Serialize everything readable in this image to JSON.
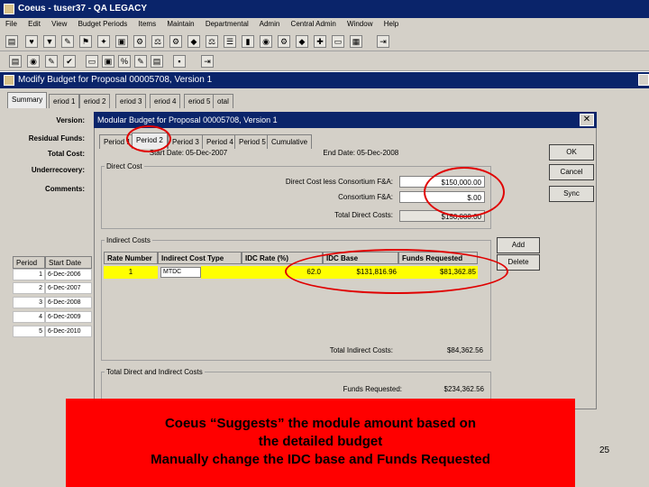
{
  "window": {
    "title": "Coeus - tuser37 - QA LEGACY"
  },
  "menu": [
    "File",
    "Edit",
    "View",
    "Budget Periods",
    "Items",
    "Maintain",
    "Departmental",
    "Admin",
    "Central Admin",
    "Window",
    "Help"
  ],
  "mdi_title": "Modify Budget for Proposal 00005708, Version 1",
  "main_tabs": [
    "Summary",
    "eriod 1",
    "eriod 2",
    "eriod 3",
    "eriod 4",
    "eriod 5",
    "otal"
  ],
  "summary_labels": {
    "version": "Version:",
    "residual_funds": "Residual Funds:",
    "total_cost": "Total Cost:",
    "underrecovery": "Underrecovery:",
    "comments": "Comments:"
  },
  "periods_grid": {
    "headers": [
      "Period",
      "Start Date"
    ],
    "rows": [
      [
        "1",
        "6-Dec-2006"
      ],
      [
        "2",
        "6-Dec-2007"
      ],
      [
        "3",
        "6-Dec-2008"
      ],
      [
        "4",
        "6-Dec-2009"
      ],
      [
        "5",
        "6-Dec-2010"
      ]
    ]
  },
  "dialog": {
    "title": "Modular Budget for Proposal 00005708, Version 1",
    "close_label": "✕",
    "tabs": [
      "Period 1",
      "Period 2",
      "Period 3",
      "Period 4",
      "Period 5",
      "Cumulative"
    ],
    "start_date_label": "Start Date:",
    "start_date": "05-Dec-2007",
    "end_date_label": "End Date:",
    "end_date": "05-Dec-2008",
    "direct_cost_group": "Direct Cost",
    "direct_less_label": "Direct Cost less Consortium F&A:",
    "direct_less_value": "$150,000.00",
    "consortium_label": "Consortium F&A:",
    "consortium_value": "$.00",
    "total_direct_label": "Total Direct Costs:",
    "total_direct_value": "$150,000.00",
    "indirect_group": "Indirect Costs",
    "indirect_headers": [
      "Rate Number",
      "Indirect Cost Type",
      "IDC Rate (%)",
      "IDC Base",
      "Funds Requested"
    ],
    "indirect_row": [
      "1",
      "MTDC",
      "62.0",
      "$131,816.96",
      "$81,362.85"
    ],
    "total_indirect_label": "Total Indirect Costs:",
    "total_indirect_value": "$84,362.56",
    "total_di_group": "Total Direct and Indirect Costs",
    "funds_requested_label": "Funds Requested:",
    "funds_requested_value": "$234,362.56",
    "buttons": {
      "ok": "OK",
      "cancel": "Cancel",
      "sync": "Sync",
      "add": "Add",
      "delete": "Delete"
    }
  },
  "callout": {
    "line1": "Coeus “Suggests” the module amount based on",
    "line2": "the detailed budget",
    "line3": "Manually change the IDC base and Funds Requested"
  },
  "page_number": "25",
  "colors": {
    "titlebar": "#0a246a",
    "highlight_row": "#ffff00",
    "callout": "#ff0000",
    "annotation_ring": "#e00000"
  }
}
